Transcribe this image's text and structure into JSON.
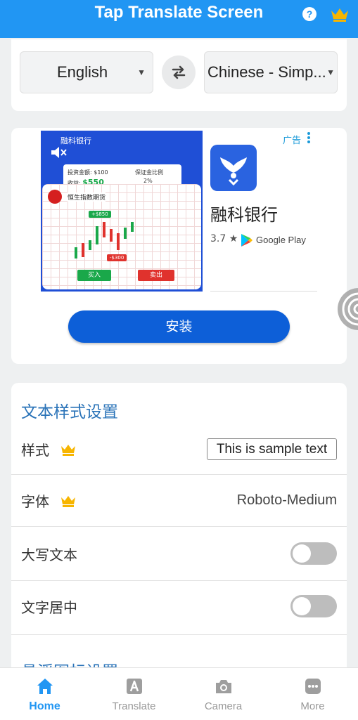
{
  "header": {
    "title": "Tap Translate Screen",
    "help_icon": "question-icon",
    "crown_icon": "crown-icon",
    "color": "#2196f3"
  },
  "languages": {
    "source": "English",
    "target": "Chinese - Simp...",
    "swap_icon": "swap-arrows-icon"
  },
  "ad": {
    "label": "广告",
    "brand_small": "融科银行",
    "app_name": "融科银行",
    "rating": "3.7 ★",
    "store": "Google Play",
    "install_label": "安装",
    "image": {
      "invest_label": "投资金额: $100",
      "margin_label": "保证金比例",
      "gain_label": "收益:",
      "gain_value": "$550",
      "margin_value": "2%",
      "chart_title": "恒生指数期货",
      "tag_up": "+$850",
      "tag_down": "-$300",
      "buy": "买入",
      "sell": "卖出"
    }
  },
  "settings": {
    "title": "文本样式设置",
    "style_label": "样式",
    "style_sample": "This is sample text",
    "font_label": "字体",
    "font_value": "Roboto-Medium",
    "uppercase_label": "大写文本",
    "uppercase_on": false,
    "center_label": "文字居中",
    "center_on": false,
    "next_title": "悬浮图标设置"
  },
  "nav": {
    "items": [
      {
        "label": "Home",
        "icon": "home-icon",
        "active": true
      },
      {
        "label": "Translate",
        "icon": "translate-icon",
        "active": false
      },
      {
        "label": "Camera",
        "icon": "camera-icon",
        "active": false
      },
      {
        "label": "More",
        "icon": "more-icon",
        "active": false
      }
    ]
  }
}
